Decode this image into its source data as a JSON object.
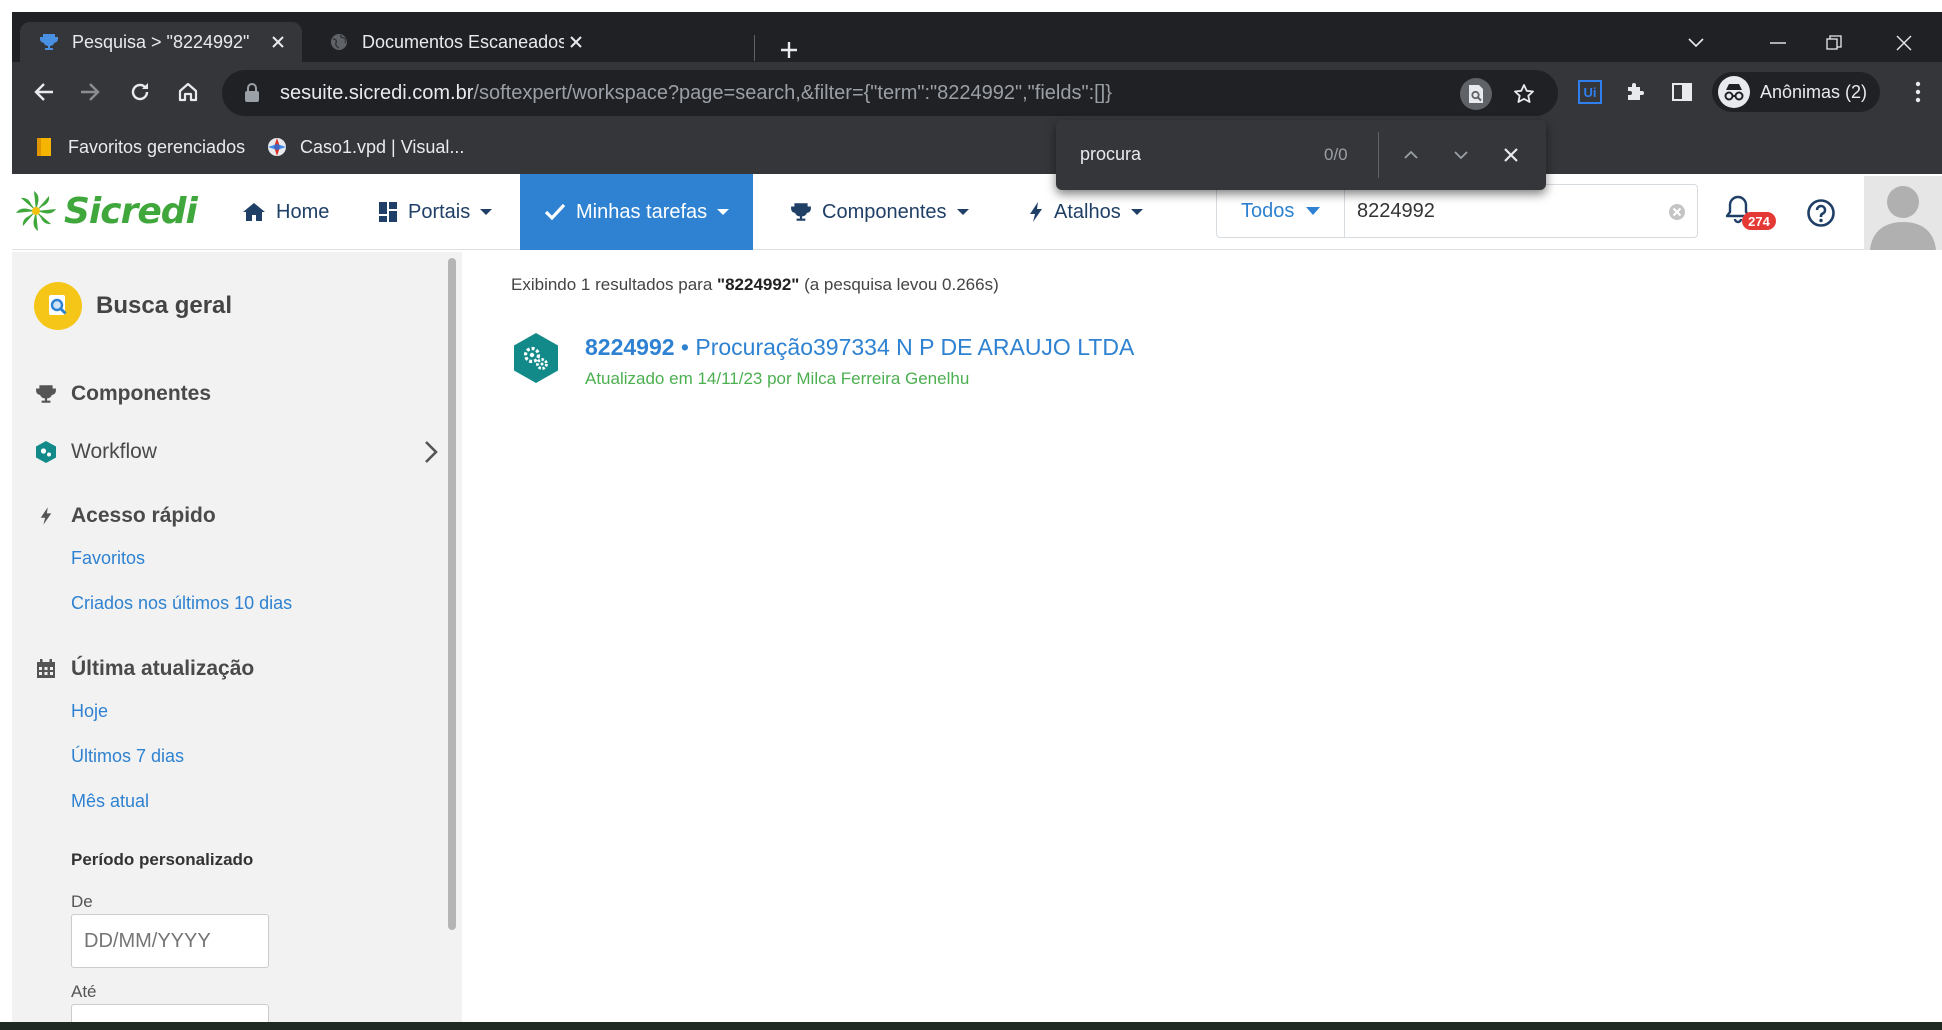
{
  "browser": {
    "tabs": [
      {
        "title": "Pesquisa > \"8224992\"",
        "active": true
      },
      {
        "title": "Documentos Escaneados",
        "active": false
      }
    ],
    "url": {
      "host": "sesuite.sicredi.com.br",
      "path": "/softexpert/workspace?page=search,&filter={\"term\":\"8224992\",\"fields\":[]}"
    },
    "profile_label": "Anônimas (2)",
    "bookmarks": [
      {
        "label": "Favoritos gerenciados",
        "icon": "folder-icon"
      },
      {
        "label": "Caso1.vpd | Visual...",
        "icon": "visual-paradigm-icon"
      }
    ]
  },
  "find_bar": {
    "query": "procura",
    "count": "0/0"
  },
  "app": {
    "logo_text": "Sicredi",
    "brand_color": "#3fa73b",
    "accent_color": "#2e82d1",
    "nav": [
      {
        "label": "Home",
        "icon": "home-icon",
        "caret": false,
        "active": false
      },
      {
        "label": "Portais",
        "icon": "grid-icon",
        "caret": true,
        "active": false
      },
      {
        "label": "Minhas tarefas",
        "icon": "check-icon",
        "caret": true,
        "active": true
      },
      {
        "label": "Componentes",
        "icon": "trophy-icon",
        "caret": true,
        "active": false
      },
      {
        "label": "Atalhos",
        "icon": "bolt-icon",
        "caret": true,
        "active": false
      }
    ],
    "search": {
      "scope": "Todos",
      "value": "8224992"
    },
    "notifications_count": "274"
  },
  "sidebar": {
    "title": "Busca geral",
    "components_heading": "Componentes",
    "workflow_label": "Workflow",
    "quick_access_heading": "Acesso rápido",
    "quick_links": [
      "Favoritos",
      "Criados nos últimos 10 dias"
    ],
    "last_update_heading": "Última atualização",
    "update_links": [
      "Hoje",
      "Últimos 7 dias",
      "Mês atual"
    ],
    "custom_period_heading": "Período personalizado",
    "from_label": "De",
    "to_label": "Até",
    "date_placeholder": "DD/MM/YYYY"
  },
  "results": {
    "summary_prefix": "Exibindo 1 resultados para ",
    "summary_term": "\"8224992\"",
    "summary_suffix": " (a pesquisa levou 0.266s)",
    "items": [
      {
        "id": "8224992",
        "separator": " • ",
        "title": "Procuração397334 N P DE ARAUJO LTDA",
        "meta": "Atualizado em 14/11/23 por Milca Ferreira Genelhu"
      }
    ]
  }
}
